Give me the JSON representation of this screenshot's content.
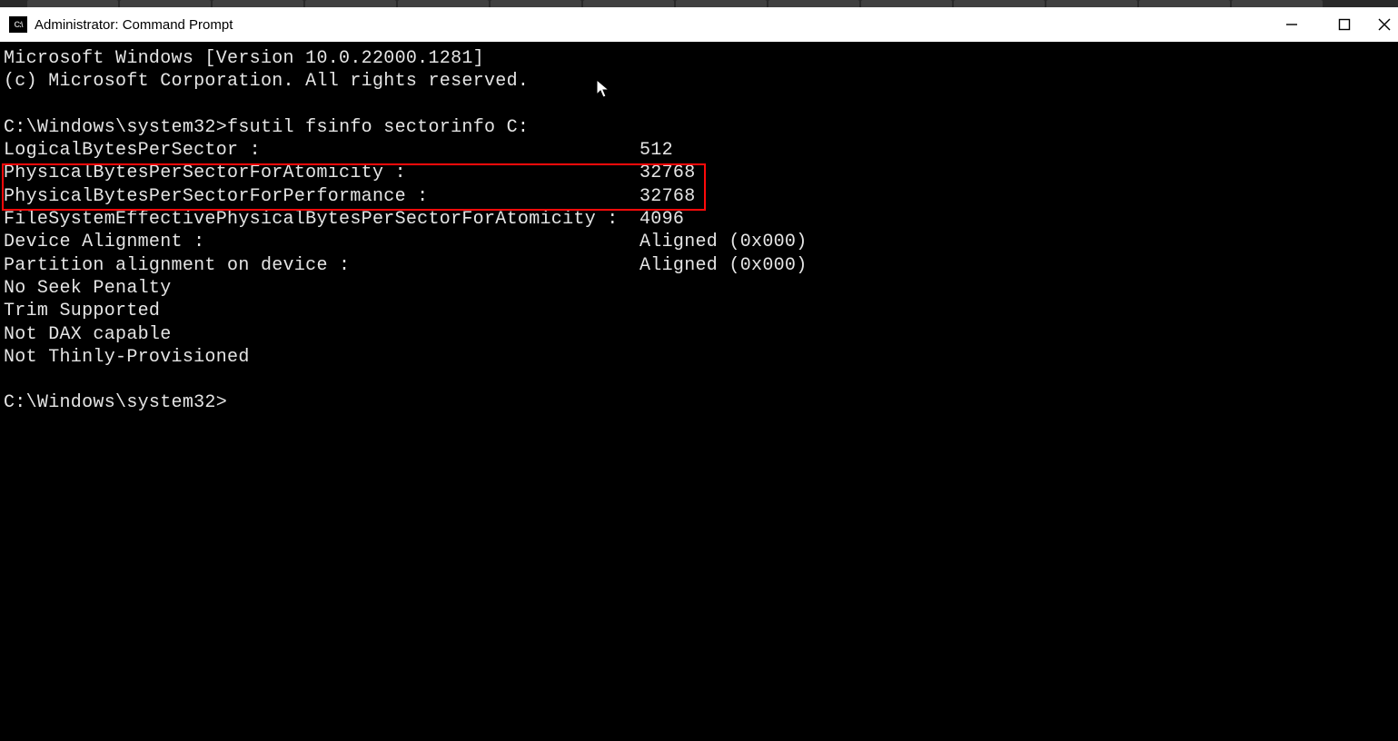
{
  "window": {
    "title": "Administrator: Command Prompt"
  },
  "terminal": {
    "header1": "Microsoft Windows [Version 10.0.22000.1281]",
    "header2": "(c) Microsoft Corporation. All rights reserved.",
    "prompt1_path": "C:\\Windows\\system32>",
    "command": "fsutil fsinfo sectorinfo C:",
    "kv": [
      {
        "key": "LogicalBytesPerSector :",
        "val": "512"
      },
      {
        "key": "PhysicalBytesPerSectorForAtomicity :",
        "val": "32768"
      },
      {
        "key": "PhysicalBytesPerSectorForPerformance :",
        "val": "32768"
      },
      {
        "key": "FileSystemEffectivePhysicalBytesPerSectorForAtomicity : ",
        "val": "4096"
      },
      {
        "key": "Device Alignment :",
        "val": "Aligned (0x000)"
      },
      {
        "key": "Partition alignment on device :",
        "val": "Aligned (0x000)"
      }
    ],
    "flags": [
      "No Seek Penalty",
      "Trim Supported",
      "Not DAX capable",
      "Not Thinly-Provisioned"
    ],
    "prompt2_path": "C:\\Windows\\system32>"
  }
}
